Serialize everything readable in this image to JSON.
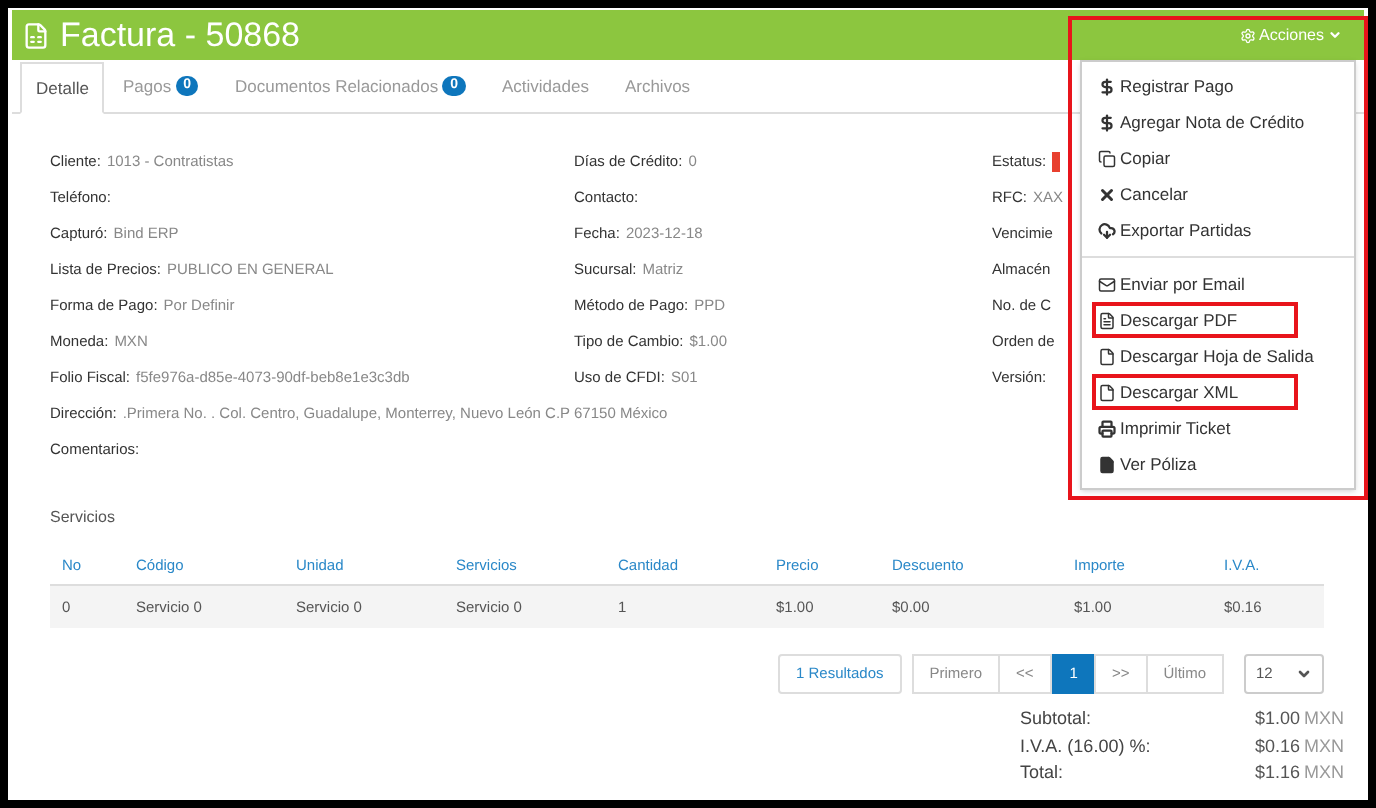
{
  "header": {
    "title": "Factura - 50868",
    "actions_label": "Acciones"
  },
  "tabs": [
    {
      "label": "Detalle",
      "selected": true
    },
    {
      "label": "Pagos",
      "badge": "0",
      "selected": false
    },
    {
      "label": "Documentos Relacionados",
      "badge": "0",
      "selected": false
    },
    {
      "label": "Actividades",
      "selected": false
    },
    {
      "label": "Archivos",
      "selected": false
    }
  ],
  "details": {
    "columns": [
      [
        {
          "label": "Cliente:",
          "value": "1013 - Contratistas"
        },
        {
          "label": "Teléfono:"
        },
        {
          "label": "Capturó:",
          "value": "Bind ERP"
        },
        {
          "label": "Lista de Precios:",
          "value": "PUBLICO EN GENERAL"
        },
        {
          "label": "Forma de Pago:",
          "value": "Por Definir"
        },
        {
          "label": "Moneda:",
          "value": "MXN"
        },
        {
          "label": "Folio Fiscal:",
          "value": "f5fe976a-d85e-4073-90df-beb8e1e3c3db"
        }
      ],
      [
        {
          "label": "Días de Crédito:",
          "value": "0"
        },
        {
          "label": "Contacto:"
        },
        {
          "label": "Fecha:",
          "value": "2023-12-18"
        },
        {
          "label": "Sucursal:",
          "value": "Matriz"
        },
        {
          "label": "Método de Pago:",
          "value": "PPD"
        },
        {
          "label": "Tipo de Cambio:",
          "value": "$1.00"
        },
        {
          "label": "Uso de CFDI:",
          "value": "S01"
        }
      ],
      [
        {
          "label": "Estatus:",
          "color": "#e8402f"
        },
        {
          "label": "RFC:",
          "value": "XAX"
        },
        {
          "label": "Vencimie"
        },
        {
          "label": "Almacén"
        },
        {
          "label": "No. de C"
        },
        {
          "label": "Orden de"
        },
        {
          "label": "Versión:"
        }
      ]
    ],
    "wide": [
      {
        "label": "Dirección:",
        "value": ".Primera No. . Col. Centro, Guadalupe, Monterrey, Nuevo León C.P 67150 México"
      },
      {
        "label": "Comentarios:"
      }
    ]
  },
  "services": {
    "title": "Servicios",
    "columns": [
      "No",
      "Código",
      "Unidad",
      "Servicios",
      "Cantidad",
      "Precio",
      "Descuento",
      "Importe",
      "I.V.A."
    ],
    "rows": [
      [
        "0",
        "Servicio 0",
        "Servicio 0",
        "Servicio 0",
        "1",
        "$1.00",
        "$0.00",
        "$1.00",
        "$0.16"
      ]
    ]
  },
  "pagination": {
    "results": "1 Resultados",
    "pages": [
      {
        "label": "Primero",
        "selected": false
      },
      {
        "label": "<<",
        "selected": false
      },
      {
        "label": "1",
        "selected": true
      },
      {
        "label": ">>",
        "selected": false
      },
      {
        "label": "Último",
        "selected": false
      }
    ],
    "page_size": "12"
  },
  "totals": [
    {
      "label": "Subtotal:",
      "amount": "$1.00",
      "currency": "MXN"
    },
    {
      "label": "I.V.A. (16.00) %:",
      "amount": "$0.16",
      "currency": "MXN"
    },
    {
      "label": "Total:",
      "amount": "$1.16",
      "currency": "MXN"
    }
  ],
  "actions_menu": {
    "highlighted": true,
    "groups": [
      [
        {
          "kind": "dollar",
          "label": "Registrar Pago",
          "highlighted": false
        },
        {
          "kind": "dollar",
          "label": "Agregar Nota de Crédito",
          "highlighted": false
        },
        {
          "kind": "copy",
          "label": "Copiar",
          "highlighted": false
        },
        {
          "kind": "cancel",
          "label": "Cancelar",
          "highlighted": false
        },
        {
          "kind": "cloud",
          "label": "Exportar Partidas",
          "highlighted": false
        }
      ],
      [
        {
          "kind": "mail",
          "label": "Enviar por Email",
          "highlighted": false
        },
        {
          "kind": "pdf",
          "label": "Descargar PDF",
          "highlighted": true
        },
        {
          "kind": "file",
          "label": "Descargar Hoja de Salida",
          "highlighted": false
        },
        {
          "kind": "file",
          "label": "Descargar XML",
          "highlighted": true
        },
        {
          "kind": "print",
          "label": "Imprimir Ticket",
          "highlighted": false
        },
        {
          "kind": "filled",
          "label": "Ver Póliza",
          "highlighted": false
        }
      ]
    ]
  }
}
